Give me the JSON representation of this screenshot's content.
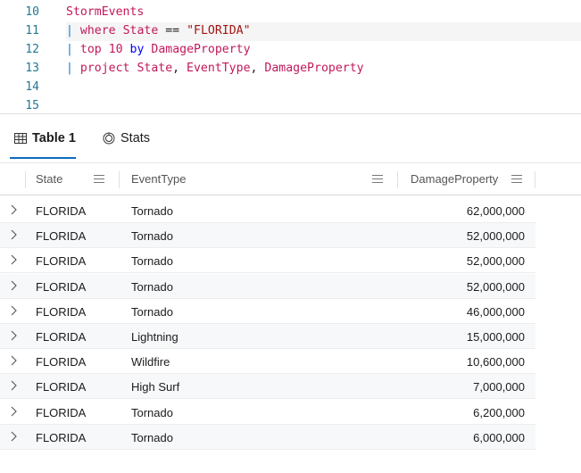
{
  "editor": {
    "line_numbers": [
      "10",
      "11",
      "12",
      "13",
      "14",
      "15"
    ],
    "line1": {
      "table": "StormEvents"
    },
    "line2": {
      "pipe": "|",
      "kw_where": "where",
      "column": "State",
      "op": "==",
      "string": "\"FLORIDA\""
    },
    "line3": {
      "pipe": "|",
      "kw_top": "top",
      "number": "10",
      "kw_by": "by",
      "column": "DamageProperty"
    },
    "line4": {
      "pipe": "|",
      "kw_project": "project",
      "col1": "State",
      "comma1": ",",
      "col2": "EventType",
      "comma2": ",",
      "col3": "DamageProperty"
    }
  },
  "tabs": [
    {
      "label": "Table 1",
      "icon": "table-icon",
      "active": true
    },
    {
      "label": "Stats",
      "icon": "stats-icon",
      "active": false
    }
  ],
  "grid": {
    "columns": [
      "State",
      "EventType",
      "DamageProperty"
    ],
    "rows": [
      [
        "FLORIDA",
        "Tornado",
        "62,000,000"
      ],
      [
        "FLORIDA",
        "Tornado",
        "52,000,000"
      ],
      [
        "FLORIDA",
        "Tornado",
        "52,000,000"
      ],
      [
        "FLORIDA",
        "Tornado",
        "52,000,000"
      ],
      [
        "FLORIDA",
        "Tornado",
        "46,000,000"
      ],
      [
        "FLORIDA",
        "Lightning",
        "15,000,000"
      ],
      [
        "FLORIDA",
        "Wildfire",
        "10,600,000"
      ],
      [
        "FLORIDA",
        "High Surf",
        "7,000,000"
      ],
      [
        "FLORIDA",
        "Tornado",
        "6,200,000"
      ],
      [
        "FLORIDA",
        "Tornado",
        "6,000,000"
      ]
    ]
  },
  "colors": {
    "accent": "#0f6cbd",
    "table_name": "#c2185b",
    "keyword": "#0000ff",
    "string": "#a31515",
    "line_number": "#237893"
  }
}
